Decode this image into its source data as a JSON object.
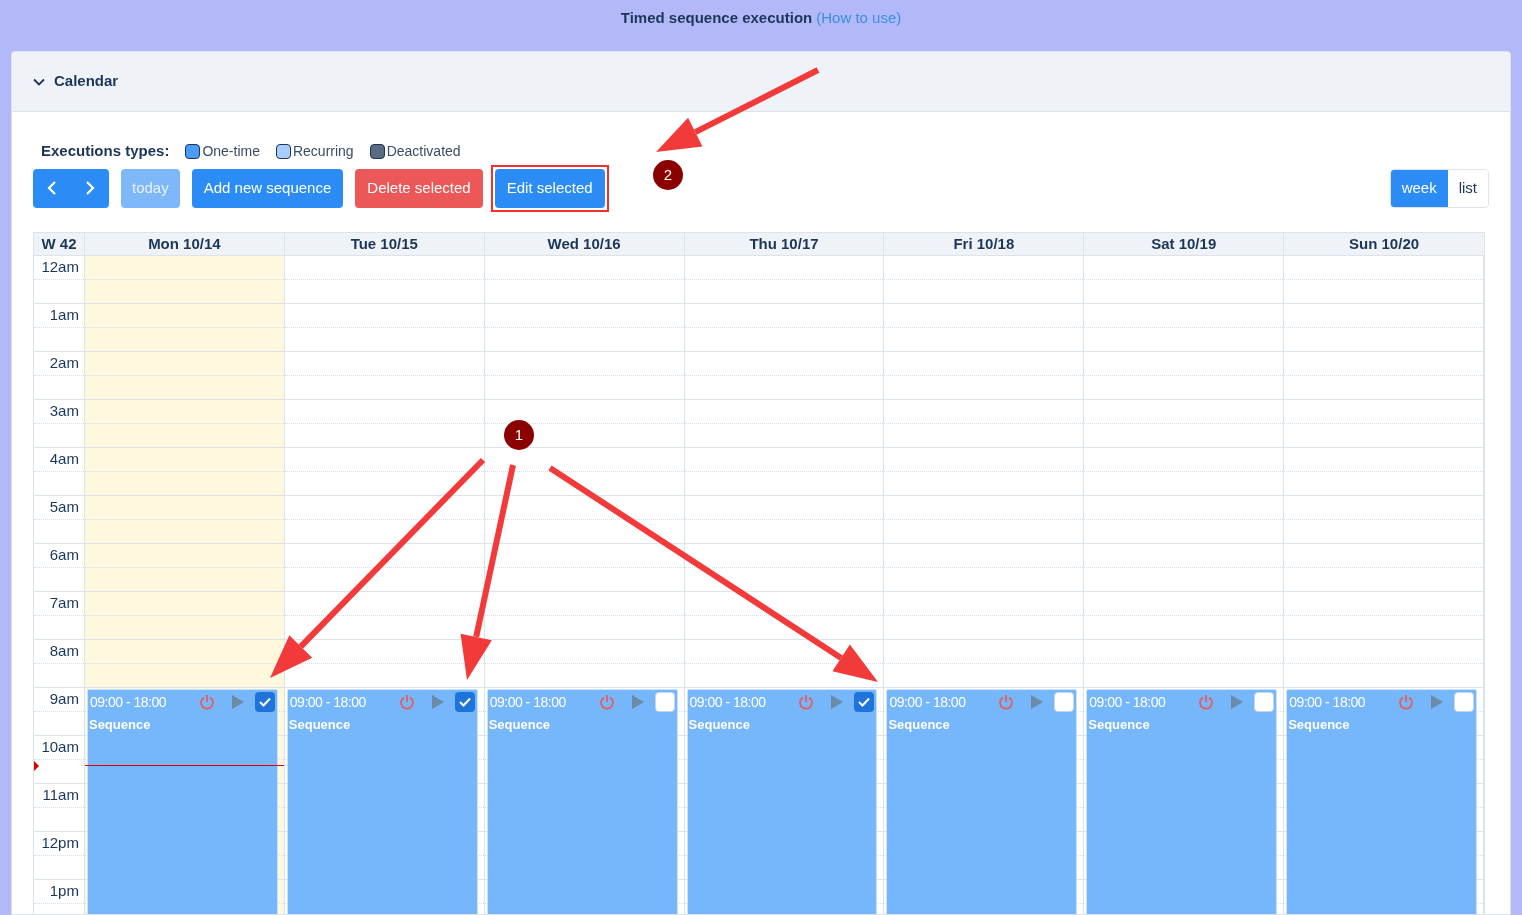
{
  "header": {
    "title": "Timed sequence execution",
    "link": "(How to use)"
  },
  "panel": {
    "title": "Calendar",
    "expanded": true
  },
  "legend": {
    "label": "Executions types:",
    "items": [
      {
        "label": "One-time",
        "color": "#4c9bf5"
      },
      {
        "label": "Recurring",
        "color": "#a9cefb"
      },
      {
        "label": "Deactivated",
        "color": "#5b6b82"
      }
    ]
  },
  "toolbar": {
    "today": {
      "label": "today",
      "disabled": true
    },
    "buttons": [
      {
        "label": "Add new sequence",
        "kind": "primary",
        "highlighted": false
      },
      {
        "label": "Delete selected",
        "kind": "danger",
        "highlighted": false
      },
      {
        "label": "Edit selected",
        "kind": "primary",
        "highlighted": true
      }
    ]
  },
  "views": [
    {
      "label": "week",
      "selected": true
    },
    {
      "label": "list",
      "selected": false
    }
  ],
  "calendar": {
    "week": "W 42",
    "days": [
      {
        "label": "Mon 10/14",
        "today": true
      },
      {
        "label": "Tue 10/15",
        "today": false
      },
      {
        "label": "Wed 10/16",
        "today": false
      },
      {
        "label": "Thu 10/17",
        "today": false
      },
      {
        "label": "Fri 10/18",
        "today": false
      },
      {
        "label": "Sat 10/19",
        "today": false
      },
      {
        "label": "Sun 10/20",
        "today": false
      }
    ],
    "hours": [
      "12am",
      "1am",
      "2am",
      "3am",
      "4am",
      "5am",
      "6am",
      "7am",
      "8am",
      "9am",
      "10am",
      "11am",
      "12pm",
      "1pm"
    ],
    "events": [
      {
        "time": "09:00 - 18:00",
        "title": "Sequence",
        "checked": true
      },
      {
        "time": "09:00 - 18:00",
        "title": "Sequence",
        "checked": true
      },
      {
        "time": "09:00 - 18:00",
        "title": "Sequence",
        "checked": false
      },
      {
        "time": "09:00 - 18:00",
        "title": "Sequence",
        "checked": true
      },
      {
        "time": "09:00 - 18:00",
        "title": "Sequence",
        "checked": false
      },
      {
        "time": "09:00 - 18:00",
        "title": "Sequence",
        "checked": false
      },
      {
        "time": "09:00 - 18:00",
        "title": "Sequence",
        "checked": false
      }
    ]
  },
  "annotations": [
    {
      "label": "1"
    },
    {
      "label": "2"
    }
  ]
}
